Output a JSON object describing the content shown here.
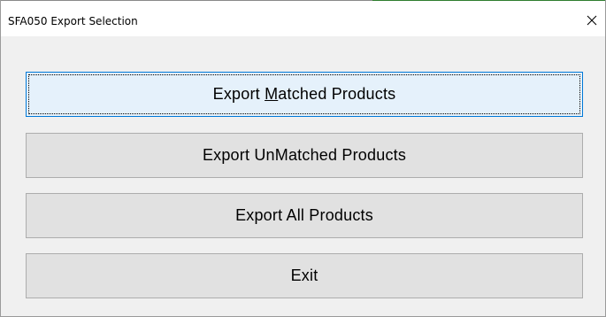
{
  "window": {
    "title": "SFA050 Export Selection"
  },
  "buttons": {
    "export_matched": {
      "prefix": "Export ",
      "mnemonic": "M",
      "suffix": "atched Products"
    },
    "export_unmatched": {
      "label": "Export UnMatched Products"
    },
    "export_all": {
      "label": "Export All Products"
    },
    "exit": {
      "label": "Exit"
    }
  },
  "icons": {
    "close": "close-icon"
  },
  "colors": {
    "default_button_border": "#0078d7",
    "default_button_fill": "#e5f1fb",
    "button_fill": "#e1e1e1",
    "dialog_background": "#f0f0f0"
  }
}
